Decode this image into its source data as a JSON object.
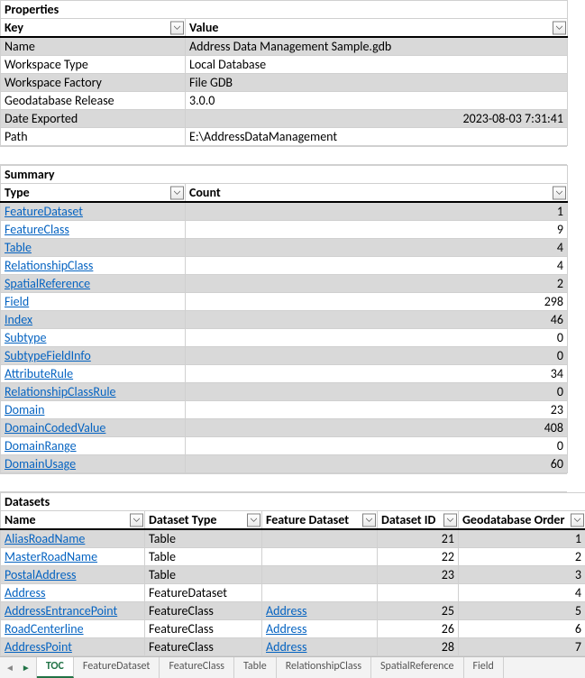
{
  "properties": {
    "title": "Properties",
    "key_header": "Key",
    "value_header": "Value",
    "rows": [
      {
        "key": "Name",
        "value": "Address Data Management Sample.gdb",
        "shaded": true
      },
      {
        "key": "Workspace Type",
        "value": "Local Database",
        "shaded": false
      },
      {
        "key": "Workspace Factory",
        "value": "File GDB",
        "shaded": true
      },
      {
        "key": "Geodatabase Release",
        "value": "3.0.0",
        "shaded": false
      },
      {
        "key": "Date Exported",
        "value": "2023-08-03 7:31:41",
        "shaded": true,
        "right": true
      },
      {
        "key": "Path",
        "value": "E:\\AddressDataManagement",
        "shaded": false
      }
    ]
  },
  "summary": {
    "title": "Summary",
    "type_header": "Type",
    "count_header": "Count",
    "rows": [
      {
        "type": "FeatureDataset",
        "count": 1,
        "shaded": true
      },
      {
        "type": "FeatureClass",
        "count": 9,
        "shaded": false
      },
      {
        "type": "Table",
        "count": 4,
        "shaded": true
      },
      {
        "type": "RelationshipClass",
        "count": 4,
        "shaded": false
      },
      {
        "type": "SpatialReference",
        "count": 2,
        "shaded": true
      },
      {
        "type": "Field",
        "count": 298,
        "shaded": false
      },
      {
        "type": "Index",
        "count": 46,
        "shaded": true
      },
      {
        "type": "Subtype",
        "count": 0,
        "shaded": false
      },
      {
        "type": "SubtypeFieldInfo",
        "count": 0,
        "shaded": true
      },
      {
        "type": "AttributeRule",
        "count": 34,
        "shaded": false
      },
      {
        "type": "RelationshipClassRule",
        "count": 0,
        "shaded": true
      },
      {
        "type": "Domain",
        "count": 23,
        "shaded": false
      },
      {
        "type": "DomainCodedValue",
        "count": 408,
        "shaded": true
      },
      {
        "type": "DomainRange",
        "count": 0,
        "shaded": false
      },
      {
        "type": "DomainUsage",
        "count": 60,
        "shaded": true
      }
    ]
  },
  "datasets": {
    "title": "Datasets",
    "headers": {
      "name": "Name",
      "type": "Dataset Type",
      "fd": "Feature Dataset",
      "id": "Dataset ID",
      "order": "Geodatabase Order"
    },
    "rows": [
      {
        "name": "AliasRoadName",
        "type": "Table",
        "fd": "",
        "id": 21,
        "order": 1,
        "shaded": true
      },
      {
        "name": "MasterRoadName",
        "type": "Table",
        "fd": "",
        "id": 22,
        "order": 2,
        "shaded": false
      },
      {
        "name": "PostalAddress",
        "type": "Table",
        "fd": "",
        "id": 23,
        "order": 3,
        "shaded": true
      },
      {
        "name": "Address",
        "type": "FeatureDataset",
        "fd": "",
        "id": "",
        "order": 4,
        "shaded": false
      },
      {
        "name": "AddressEntrancePoint",
        "type": "FeatureClass",
        "fd": "Address",
        "id": 25,
        "order": 5,
        "shaded": true
      },
      {
        "name": "RoadCenterline",
        "type": "FeatureClass",
        "fd": "Address",
        "id": 26,
        "order": 6,
        "shaded": false
      },
      {
        "name": "AddressPoint",
        "type": "FeatureClass",
        "fd": "Address",
        "id": 28,
        "order": 7,
        "shaded": true
      }
    ]
  },
  "tabs": [
    "TOC",
    "FeatureDataset",
    "FeatureClass",
    "Table",
    "RelationshipClass",
    "SpatialReference",
    "Field"
  ],
  "active_tab": "TOC"
}
